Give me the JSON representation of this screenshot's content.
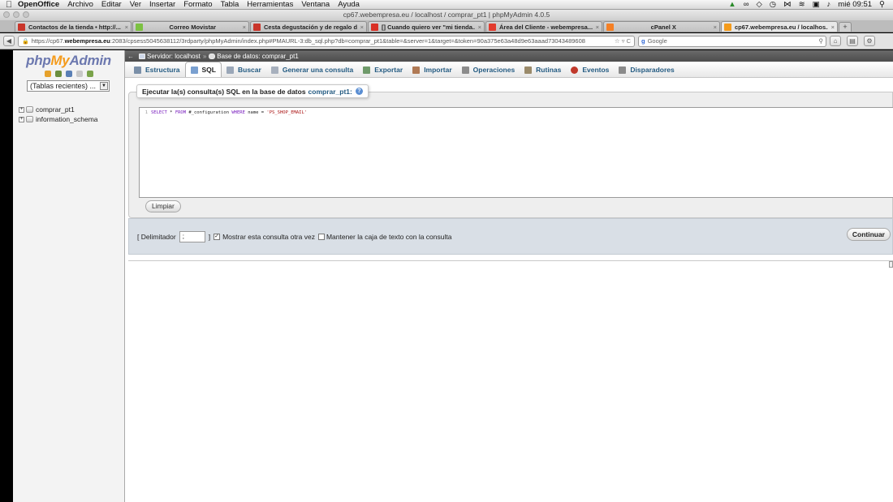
{
  "menubar": {
    "app": "OpenOffice",
    "menus": [
      "Archivo",
      "Editar",
      "Ver",
      "Insertar",
      "Formato",
      "Tabla",
      "Herramientas",
      "Ventana",
      "Ayuda"
    ],
    "clock": "mié 09:51"
  },
  "window": {
    "title": "cp67.webempresa.eu / localhost / comprar_pt1 | phpMyAdmin 4.0.5"
  },
  "browser_tabs": [
    {
      "title": "Contactos de la tienda • http://...",
      "favicon_color": "#c9352a"
    },
    {
      "title": "Correo Movistar",
      "favicon_color": "#7cc142"
    },
    {
      "title": "Cesta degustación y de regalo d...",
      "favicon_color": "#c9352a"
    },
    {
      "title": "[] Cuando quiero ver \"mi tienda...",
      "favicon_color": "#d93025"
    },
    {
      "title": "Área del Cliente - webempresa...",
      "favicon_color": "#e23b2e"
    },
    {
      "title": "cPanel X",
      "favicon_color": "#f58025"
    },
    {
      "title": "cp67.webempresa.eu / localhos...",
      "favicon_color": "#f49b1c",
      "active": true
    }
  ],
  "url": {
    "prefix": "https://cp67.",
    "domain": "webempresa.eu",
    "path": ":2083/cpsess5045638112/3rdparty/phpMyAdmin/index.php#PMAURL-3:db_sql.php?db=comprar_pt1&table=&server=1&target=&token=90a375e63a48d9e63aaad73043489608",
    "search_engine": "Google"
  },
  "pma": {
    "logo": {
      "php": "php",
      "my": "My",
      "admin": "Admin"
    },
    "recent_tables": "(Tablas recientes) ...",
    "databases": [
      "comprar_pt1",
      "information_schema"
    ],
    "breadcrumb": {
      "server": "Servidor: localhost",
      "database": "Base de datos: comprar_pt1"
    },
    "tabs": [
      {
        "label": "Estructura",
        "color": "#7a8fa8"
      },
      {
        "label": "SQL",
        "color": "#7aa0d0",
        "active": true
      },
      {
        "label": "Buscar",
        "color": "#9aa7b8"
      },
      {
        "label": "Generar una consulta",
        "color": "#a7b0bd"
      },
      {
        "label": "Exportar",
        "color": "#6f9a6a"
      },
      {
        "label": "Importar",
        "color": "#b07a55"
      },
      {
        "label": "Operaciones",
        "color": "#8c8c8c"
      },
      {
        "label": "Rutinas",
        "color": "#9a8a6a"
      },
      {
        "label": "Eventos",
        "color": "#c0392b"
      },
      {
        "label": "Disparadores",
        "color": "#8a8a8a"
      }
    ],
    "sql_panel": {
      "legend": "Ejecutar la(s) consulta(s) SQL en la base de datos",
      "db_name": "comprar_pt1:",
      "help_icon": "?",
      "line_number": "1",
      "query": {
        "kw1": "SELECT",
        "star": " * ",
        "kw2": "FROM",
        "table": " #_configuration ",
        "kw3": "WHERE",
        "cond": " name = ",
        "literal": "'PS_SHOP_EMAIL'"
      },
      "clear_label": "Limpiar"
    },
    "options": {
      "delimiter_label_open": "[ Delimitador",
      "delimiter_value": ";",
      "delimiter_label_close": "]",
      "show_again_label": "Mostrar esta consulta otra vez",
      "show_again_checked": true,
      "keep_box_label": "Mantener la caja de texto con la consulta",
      "keep_box_checked": false,
      "go_label": "Continuar"
    }
  }
}
